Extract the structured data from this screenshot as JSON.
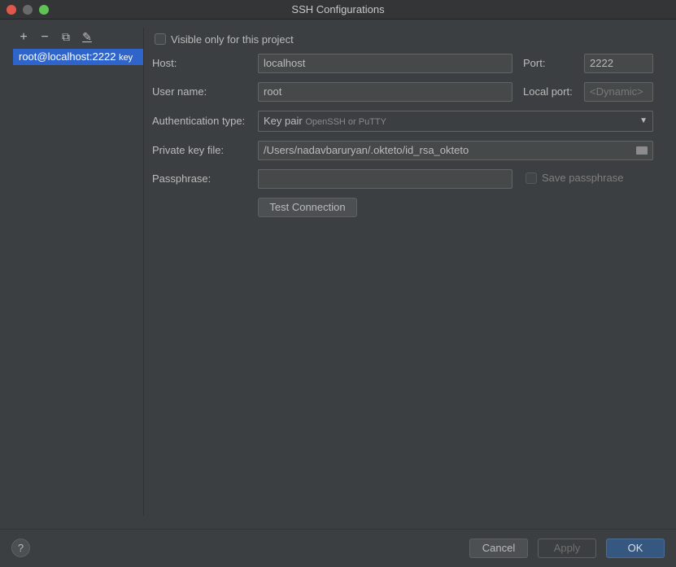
{
  "window": {
    "title": "SSH Configurations"
  },
  "sidebar": {
    "toolbar": [
      {
        "icon": "plus-icon",
        "glyph": "+"
      },
      {
        "icon": "minus-icon",
        "glyph": "−"
      },
      {
        "icon": "copy-icon",
        "glyph": "⧉"
      },
      {
        "icon": "edit-icon",
        "glyph": "✎"
      }
    ],
    "items": [
      {
        "name": "root@localhost:2222",
        "tag": "key",
        "selected": true
      }
    ]
  },
  "form": {
    "visible_only": {
      "label": "Visible only for this project",
      "checked": false
    },
    "host": {
      "label": "Host:",
      "value": "localhost"
    },
    "port": {
      "label": "Port:",
      "value": "2222"
    },
    "username": {
      "label": "User name:",
      "value": "root"
    },
    "local_port": {
      "label": "Local port:",
      "placeholder": "<Dynamic>"
    },
    "auth_type": {
      "label": "Authentication type:",
      "value": "Key pair",
      "hint": "OpenSSH or PuTTY"
    },
    "private_key": {
      "label": "Private key file:",
      "value": "/Users/nadavbaruryan/.okteto/id_rsa_okteto"
    },
    "passphrase": {
      "label": "Passphrase:",
      "value": ""
    },
    "save_passphrase": {
      "label": "Save passphrase",
      "checked": false
    },
    "test_connection": "Test Connection"
  },
  "footer": {
    "help": "?",
    "cancel": "Cancel",
    "apply": "Apply",
    "ok": "OK"
  },
  "colors": {
    "accent": "#2f65ca",
    "ok_button": "#365880",
    "background": "#3c3f41"
  }
}
